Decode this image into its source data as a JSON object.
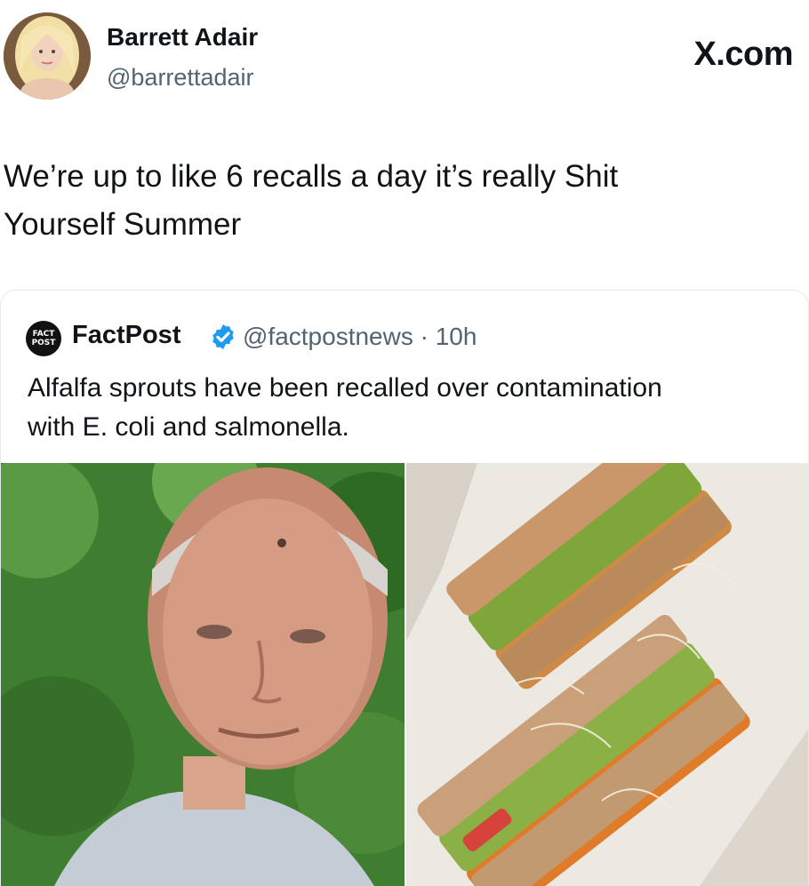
{
  "post": {
    "display_name": "Barrett Adair",
    "handle": "@barrettadair",
    "site_label": "X.com",
    "text_line1": "We’re up to like 6 recalls a day it’s really Shit",
    "text_line2": "Yourself Summer"
  },
  "quoted_post": {
    "logo_top": "FACT",
    "logo_bottom": "POST",
    "display_name": "FactPost",
    "handle_time": "@factpostnews · 10h",
    "text_line1": "Alfalfa sprouts have been recalled over contamination",
    "text_line2": "with E. coli and salmonella."
  },
  "colors": {
    "verified_badge": "#1d9bf0",
    "secondary_text": "#536471",
    "primary_text": "#0f1419"
  },
  "icons": {
    "verified": "verified-badge-icon"
  }
}
